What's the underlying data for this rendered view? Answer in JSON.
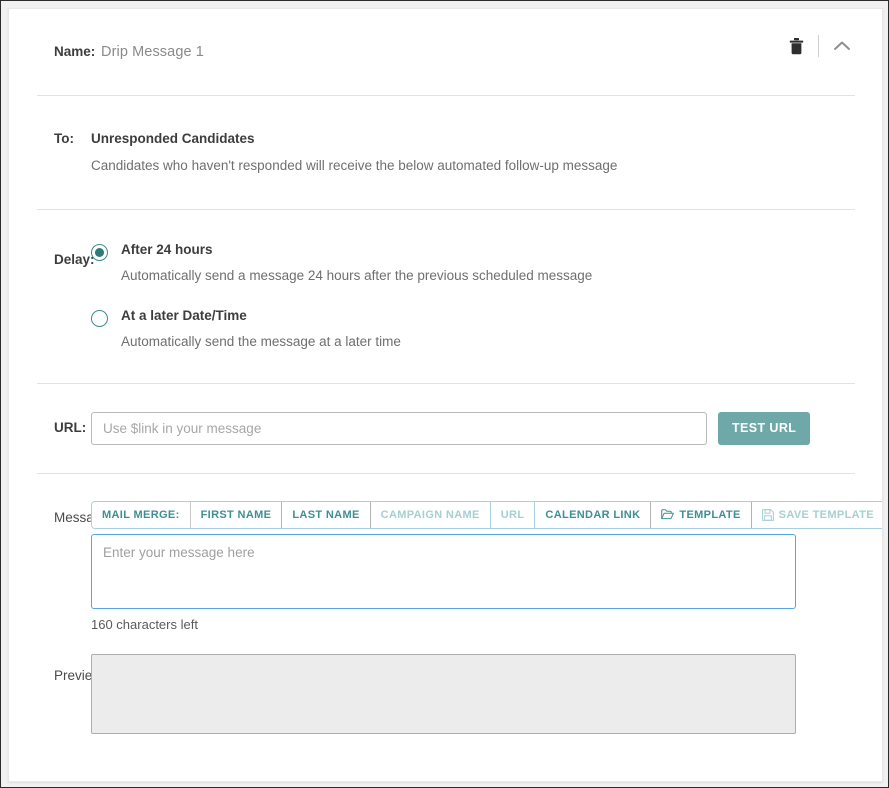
{
  "header": {
    "name_label": "Name:",
    "name_value": "Drip Message 1",
    "delete_icon": "trash-icon",
    "collapse_icon": "chevron-up-icon"
  },
  "to_section": {
    "label": "To:",
    "title": "Unresponded Candidates",
    "description": "Candidates who haven't responded will receive the below automated follow-up message"
  },
  "delay_section": {
    "label": "Delay:",
    "options": [
      {
        "title": "After 24 hours",
        "description": "Automatically send a message 24 hours after the previous scheduled message",
        "selected": true
      },
      {
        "title": "At a later Date/Time",
        "description": "Automatically send the message at a later time",
        "selected": false
      }
    ]
  },
  "url_section": {
    "label": "URL:",
    "placeholder": "Use $link in your message",
    "value": "",
    "test_button": "TEST URL"
  },
  "message_section": {
    "label": "Message",
    "toolbar": [
      {
        "text": "MAIL MERGE:",
        "kind": "label",
        "icon": ""
      },
      {
        "text": "FIRST NAME",
        "kind": "active",
        "icon": ""
      },
      {
        "text": "LAST NAME",
        "kind": "active",
        "icon": ""
      },
      {
        "text": "CAMPAIGN NAME",
        "kind": "disabled",
        "icon": ""
      },
      {
        "text": "URL",
        "kind": "disabled",
        "icon": ""
      },
      {
        "text": "CALENDAR LINK",
        "kind": "active",
        "icon": ""
      },
      {
        "text": "TEMPLATE",
        "kind": "active",
        "icon": "folder-open-icon"
      },
      {
        "text": "SAVE TEMPLATE",
        "kind": "disabled",
        "icon": "floppy-save-icon"
      }
    ],
    "placeholder": "Enter your message here",
    "value": "",
    "char_count": "160 characters left"
  },
  "preview_section": {
    "label": "Preview",
    "value": ""
  },
  "colors": {
    "accent_teal": "#3e8f95",
    "radio_teal": "#2d7b7b",
    "button_teal": "#6fa8a8",
    "focus_blue": "#56a5e0",
    "toolbar_border": "#a9cfe4",
    "divider": "#e2e2e2",
    "preview_bg": "#ececec"
  }
}
